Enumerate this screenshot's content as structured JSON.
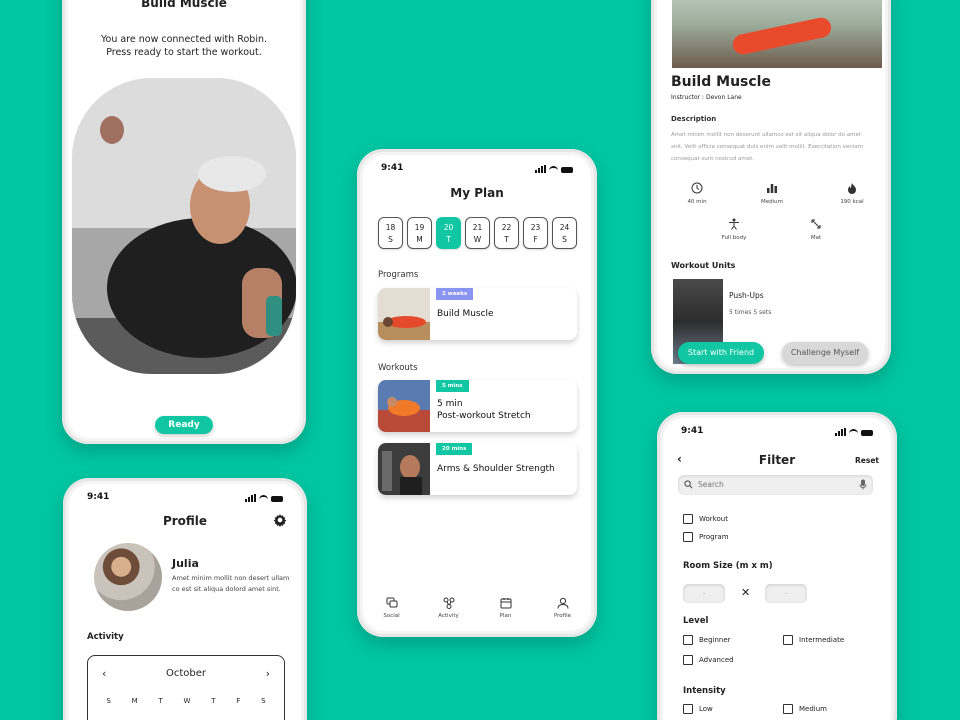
{
  "status_time": "9:41",
  "connect": {
    "heading": "Build Muscle",
    "message": "You are now connected with Robin.\nPress ready to start the workout.",
    "ready_label": "Ready"
  },
  "profile": {
    "title": "Profile",
    "name": "Julia",
    "bio": "Amet minim mollit non desert ullam co est sit aliqua dolord amet sint.",
    "activity_label": "Activity",
    "calendar": {
      "month": "October",
      "prev": "‹",
      "next": "›",
      "weekdays": [
        "S",
        "M",
        "T",
        "W",
        "T",
        "F",
        "S"
      ]
    }
  },
  "plan": {
    "title": "My Plan",
    "week": [
      {
        "num": "18",
        "day": "S",
        "active": false
      },
      {
        "num": "19",
        "day": "M",
        "active": false
      },
      {
        "num": "20",
        "day": "T",
        "active": true
      },
      {
        "num": "21",
        "day": "W",
        "active": false
      },
      {
        "num": "22",
        "day": "T",
        "active": false
      },
      {
        "num": "23",
        "day": "F",
        "active": false
      },
      {
        "num": "24",
        "day": "S",
        "active": false
      }
    ],
    "programs_label": "Programs",
    "program_card": {
      "tag": "2 weeks",
      "name": "Build Muscle",
      "tag_color": "#8a95f2"
    },
    "workouts_label": "Workouts",
    "workout_cards": [
      {
        "tag": "5 mins",
        "name": "5 min\nPost-workout Stretch",
        "tag_color": "#11c7a3"
      },
      {
        "tag": "20 mins",
        "name": "Arms & Shoulder Strength",
        "tag_color": "#11c7a3"
      }
    ],
    "nav": [
      {
        "label": "Social",
        "icon": "chat-icon"
      },
      {
        "label": "Activity",
        "icon": "activity-icon"
      },
      {
        "label": "Plan",
        "icon": "calendar-icon"
      },
      {
        "label": "Profile",
        "icon": "user-icon"
      }
    ]
  },
  "detail": {
    "title": "Build Muscle",
    "instructor": "Instructor : Devon Lane",
    "description_label": "Description",
    "description": "Amet minim mollit non deserunt ullamco est sit aliqua dolor do amet sint. Velit officia consequat duis enim velit mollit. Exercitation veniam consequat sunt nostrud amet.",
    "stats": [
      {
        "label": "40 min",
        "icon": "clock-icon"
      },
      {
        "label": "Medium",
        "icon": "bar-chart-icon"
      },
      {
        "label": "190 kcal",
        "icon": "flame-icon"
      },
      {
        "label": "Full body",
        "icon": "body-icon"
      },
      {
        "label": "Mat",
        "icon": "mat-icon"
      }
    ],
    "units_label": "Workout Units",
    "unit": {
      "name": "Push-Ups",
      "sets": "5 times 5 sets"
    },
    "start_friend": "Start with Friend",
    "challenge": "Challenge Myself"
  },
  "filter": {
    "title": "Filter",
    "back": "‹",
    "reset": "Reset",
    "search_placeholder": "Search",
    "types": [
      "Workout",
      "Program"
    ],
    "room_size_label": "Room Size (m x m)",
    "room_placeholder": "-",
    "times": "✕",
    "level_label": "Level",
    "levels": [
      "Beginner",
      "Intermediate",
      "Advanced"
    ],
    "intensity_label": "Intensity",
    "intensities": [
      "Low",
      "Medium"
    ]
  },
  "colors": {
    "background": "#00c6a2",
    "accent": "#11c7a3",
    "tag_purple": "#8a95f2"
  }
}
